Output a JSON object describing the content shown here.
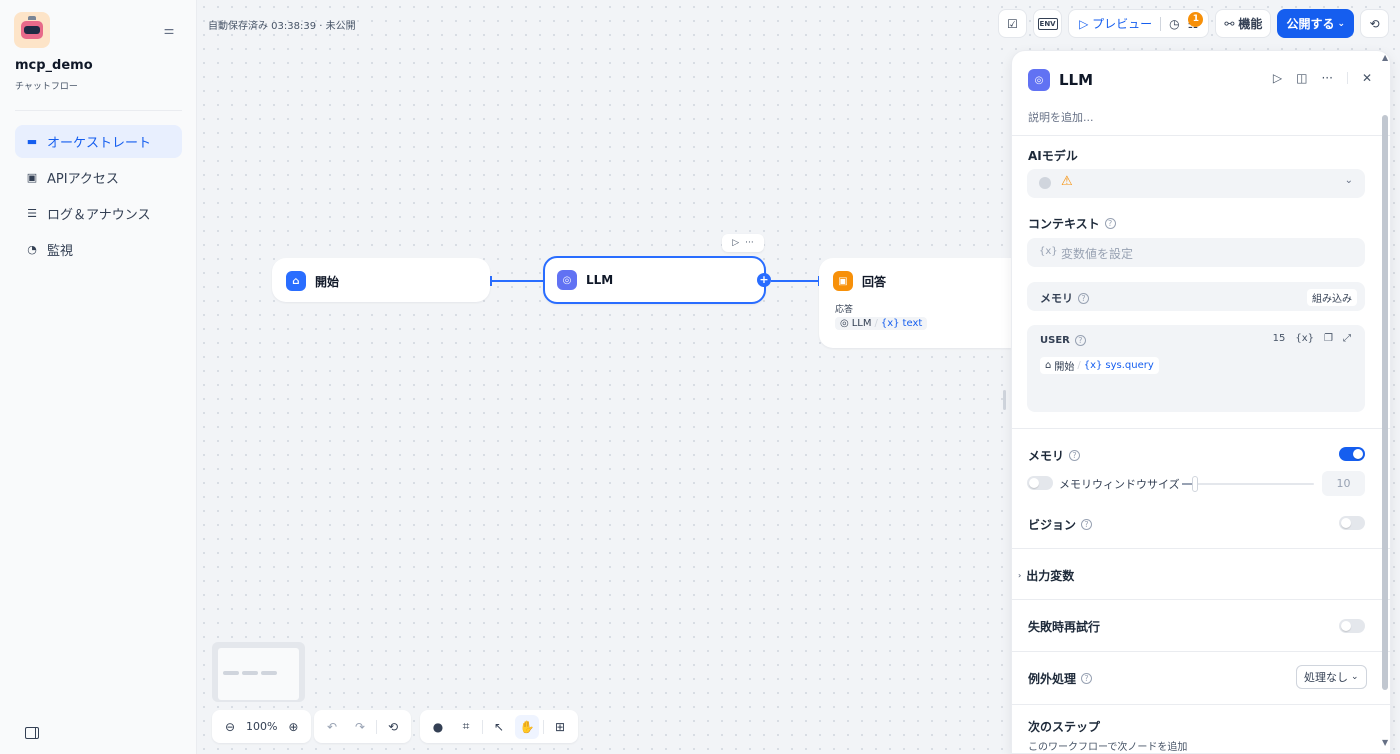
{
  "sidebar": {
    "app_name": "mcp_demo",
    "app_type": "チャットフロー",
    "items": [
      {
        "label": "オーケストレート",
        "icon": "layout-icon",
        "active": true
      },
      {
        "label": "APIアクセス",
        "icon": "terminal-icon"
      },
      {
        "label": "ログ＆アナウンス",
        "icon": "log-icon"
      },
      {
        "label": "監視",
        "icon": "monitor-icon"
      }
    ]
  },
  "canvas": {
    "autosave": "自動保存済み 03:38:39 · 未公開",
    "zoom": "100%"
  },
  "topbar": {
    "env_label": "ENV",
    "preview_label": "▷ プレビュー",
    "badge_count": "1",
    "features_label": "機能",
    "publish_label": "公開する"
  },
  "nodes": {
    "start": {
      "title": "開始"
    },
    "llm": {
      "title": "LLM"
    },
    "answer": {
      "title": "回答",
      "sub_label": "応答",
      "var_node": "LLM",
      "var_name": "text"
    }
  },
  "panel": {
    "title": "LLM",
    "description_placeholder": "説明を追加...",
    "model_label": "AIモデル",
    "context_label": "コンテキスト",
    "context_placeholder": "変数値を設定",
    "memory_label": "メモリ",
    "builtin_label": "組み込み",
    "user_label": "USER",
    "user_count": "15",
    "user_var_node": "開始",
    "user_var_name": "sys.query",
    "memory2_label": "メモリ",
    "memory_window_label": "メモリウィンドウサイズ",
    "memory_window_value": "10",
    "vision_label": "ビジョン",
    "output_vars_label": "出力変数",
    "retry_label": "失敗時再試行",
    "exception_label": "例外処理",
    "exception_value": "処理なし",
    "next_step_label": "次のステップ",
    "next_step_desc": "このワークフローで次ノードを追加"
  },
  "colors": {
    "accent": "#155eef",
    "start_node": "#296dff",
    "llm_node": "#6172f3",
    "answer_node": "#f79009",
    "warning": "#f79009"
  }
}
